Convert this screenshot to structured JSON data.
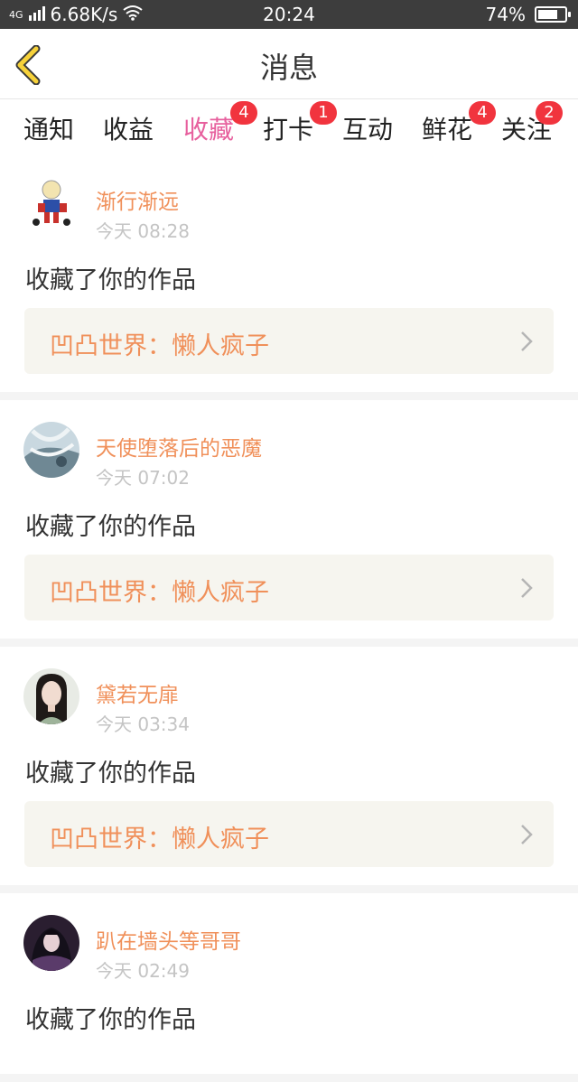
{
  "status": {
    "network": "4G",
    "speed": "6.68K/s",
    "time": "20:24",
    "battery": "74%",
    "battery_level": 0.74
  },
  "nav": {
    "title": "消息"
  },
  "tabs": [
    {
      "label": "通知",
      "badge": null
    },
    {
      "label": "收益",
      "badge": null
    },
    {
      "label": "收藏",
      "badge": "4",
      "active": true
    },
    {
      "label": "打卡",
      "badge": "1"
    },
    {
      "label": "互动",
      "badge": null
    },
    {
      "label": "鲜花",
      "badge": "4"
    },
    {
      "label": "关注",
      "badge": "2"
    }
  ],
  "items": [
    {
      "username": "渐行渐远",
      "time": "今天 08:28",
      "action": "收藏了你的作品",
      "work": "凹凸世界：懒人疯子"
    },
    {
      "username": "天使堕落后的恶魔",
      "time": "今天 07:02",
      "action": "收藏了你的作品",
      "work": "凹凸世界：懒人疯子"
    },
    {
      "username": "黛若无扉",
      "time": "今天 03:34",
      "action": "收藏了你的作品",
      "work": "凹凸世界：懒人疯子"
    },
    {
      "username": "趴在墙头等哥哥",
      "time": "今天 02:49",
      "action": "收藏了你的作品",
      "work": ""
    }
  ]
}
